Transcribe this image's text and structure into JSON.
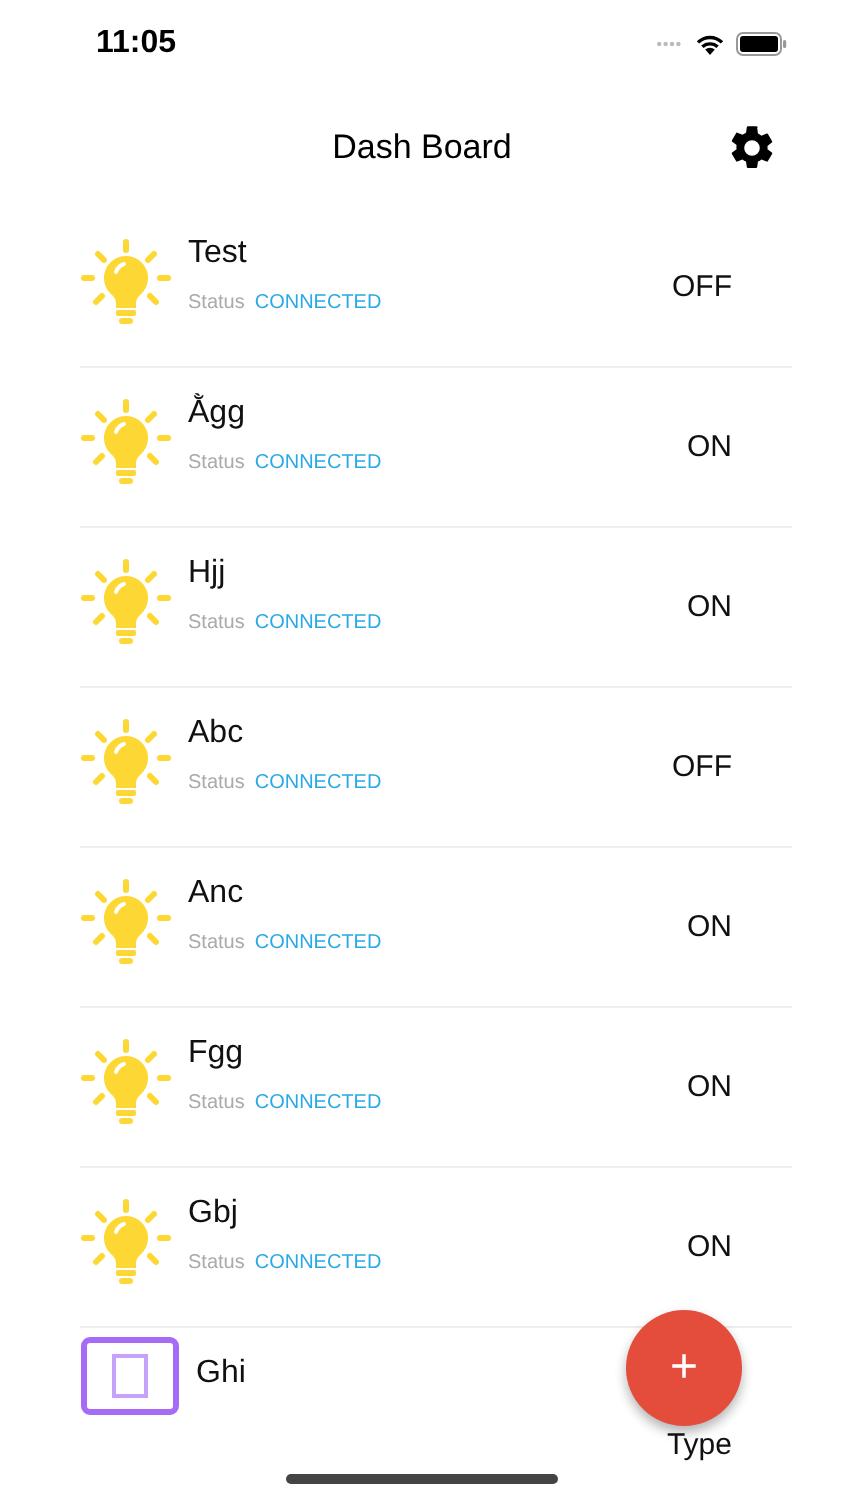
{
  "status_bar": {
    "time": "11:05"
  },
  "header": {
    "title": "Dash Board"
  },
  "devices": [
    {
      "kind": "bulb",
      "name": "Test",
      "status_label": "Status",
      "status": "CONNECTED",
      "state": "OFF"
    },
    {
      "kind": "bulb",
      "name": "Ằgg",
      "status_label": "Status",
      "status": "CONNECTED",
      "state": "ON"
    },
    {
      "kind": "bulb",
      "name": "Hjj",
      "status_label": "Status",
      "status": "CONNECTED",
      "state": "ON"
    },
    {
      "kind": "bulb",
      "name": "Abc",
      "status_label": "Status",
      "status": "CONNECTED",
      "state": "OFF"
    },
    {
      "kind": "bulb",
      "name": "Anc",
      "status_label": "Status",
      "status": "CONNECTED",
      "state": "ON"
    },
    {
      "kind": "bulb",
      "name": "Fgg",
      "status_label": "Status",
      "status": "CONNECTED",
      "state": "ON"
    },
    {
      "kind": "bulb",
      "name": "Gbj",
      "status_label": "Status",
      "status": "CONNECTED",
      "state": "ON"
    },
    {
      "kind": "panel",
      "name": "Ghi",
      "state": "Type"
    }
  ],
  "fab": {
    "label": "+"
  }
}
